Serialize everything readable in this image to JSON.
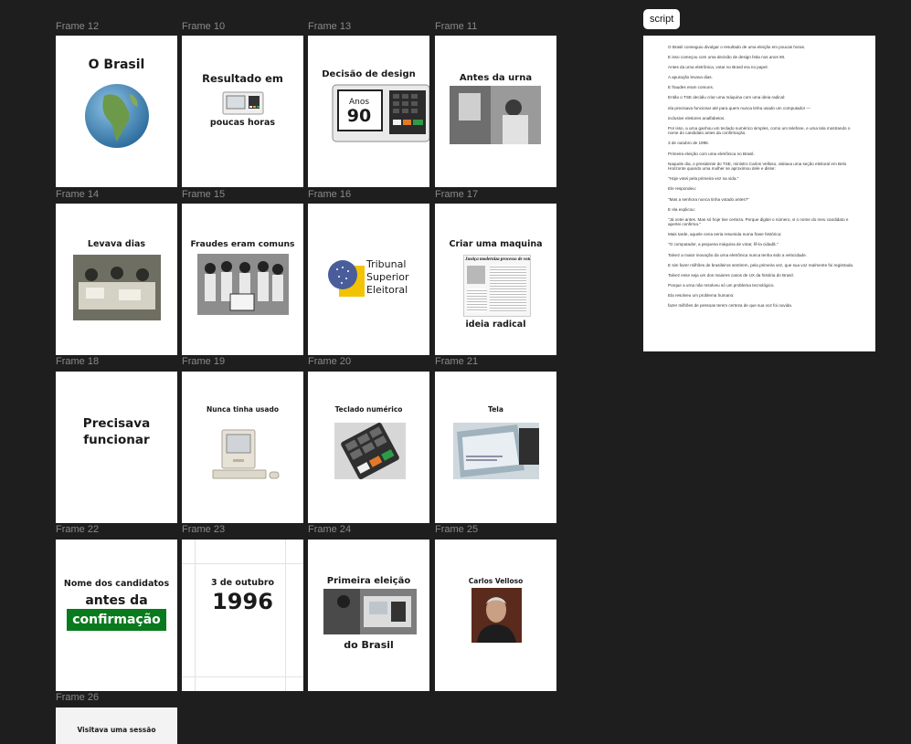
{
  "frames": [
    {
      "label": "Frame 12",
      "title": "O Brasil"
    },
    {
      "label": "Frame 10",
      "title": "Resultado em",
      "subtitle": "poucas horas"
    },
    {
      "label": "Frame 13",
      "title": "Decisão de design",
      "overlay_small": "Anos",
      "overlay_big": "90"
    },
    {
      "label": "Frame 11",
      "title": "Antes da urna"
    },
    {
      "label": "Frame 14",
      "title": "Levava dias"
    },
    {
      "label": "Frame 15",
      "title": "Fraudes eram comuns"
    },
    {
      "label": "Frame 16",
      "logo_line1": "Tribunal",
      "logo_line2": "Superior",
      "logo_line3": "Eleitoral"
    },
    {
      "label": "Frame 17",
      "title": "Criar uma maquina",
      "subtitle": "ideia radical",
      "newspaper_headline": "Justiça moderniza processo de votação"
    },
    {
      "label": "Frame 18",
      "title_line1": "Precisava",
      "title_line2": "funcionar"
    },
    {
      "label": "Frame 19",
      "title": "Nunca tinha usado"
    },
    {
      "label": "Frame 20",
      "title": "Teclado numérico"
    },
    {
      "label": "Frame 21",
      "title": "Tela"
    },
    {
      "label": "Frame 22",
      "line1": "Nome dos candidatos",
      "line2": "antes da",
      "highlight": "confirmação",
      "highlight_color": "#0a7a1e"
    },
    {
      "label": "Frame 23",
      "line1": "3 de outubro",
      "line2": "1996"
    },
    {
      "label": "Frame 24",
      "title": "Primeira eleição",
      "subtitle": "do Brasil"
    },
    {
      "label": "Frame 25",
      "title": "Carlos Velloso"
    },
    {
      "label": "Frame 26",
      "title": "Visitava uma sessão"
    }
  ],
  "script": {
    "tag": "script",
    "lines": [
      "O Brasil conseguiu divulgar o resultado de uma eleição em poucas horas.",
      "E isso começou com uma decisão de design feita nos anos 90.",
      "Antes da urna eletrônica, votar no Brasil era no papel.",
      "A apuração levava dias.",
      "E fraudes eram comuns.",
      "Então o TSE decidiu criar uma máquina com uma ideia radical:",
      "ela precisava funcionar até para quem nunca tinha usado um computador —",
      "inclusive eleitores analfabetos.",
      "Por isso, a urna ganhou um teclado numérico simples, como um telefone, e uma tela mostrando o nome do candidato antes da confirmação.",
      "3 de outubro de 1996.",
      "Primeira eleição com uma eletrônica no Brasil.",
      "Naquele dia, o presidente do TSE, ministro Carlos Velloso, visitava uma seção eleitoral em Belo Horizonte quando uma mulher se aproximou dele e disse:",
      "\"Hoje votei pela primeira vez na vida.\"",
      "Ele respondeu:",
      "\"Mas a senhora nunca tinha votado antes?\"",
      "E ela explicou:",
      "\"Já votei antes. Mas só hoje tive certeza. Porque digitei o número, vi o nome do meu candidato e apertei confirma.\"",
      "Mais tarde, aquele cena seria resumida numa frase histórica:",
      "\"O computador, a pequena máquina de votar, fê-la cidadã.\"",
      "Talvez a maior inovação da urna eletrônica nunca tenha sido a velocidade.",
      "E sim fazer milhões de brasileiros sentirem, pela primeira vez, que sua voz realmente foi registrada.",
      "Talvez esse seja um dos maiores casos de UX da história do Brasil.",
      "Porque a urna não resolveu só um problema tecnológico.",
      "Ela resolveu um problema humano:",
      "fazer milhões de pessoas terem certeza de que sua voz foi ouvida."
    ]
  }
}
